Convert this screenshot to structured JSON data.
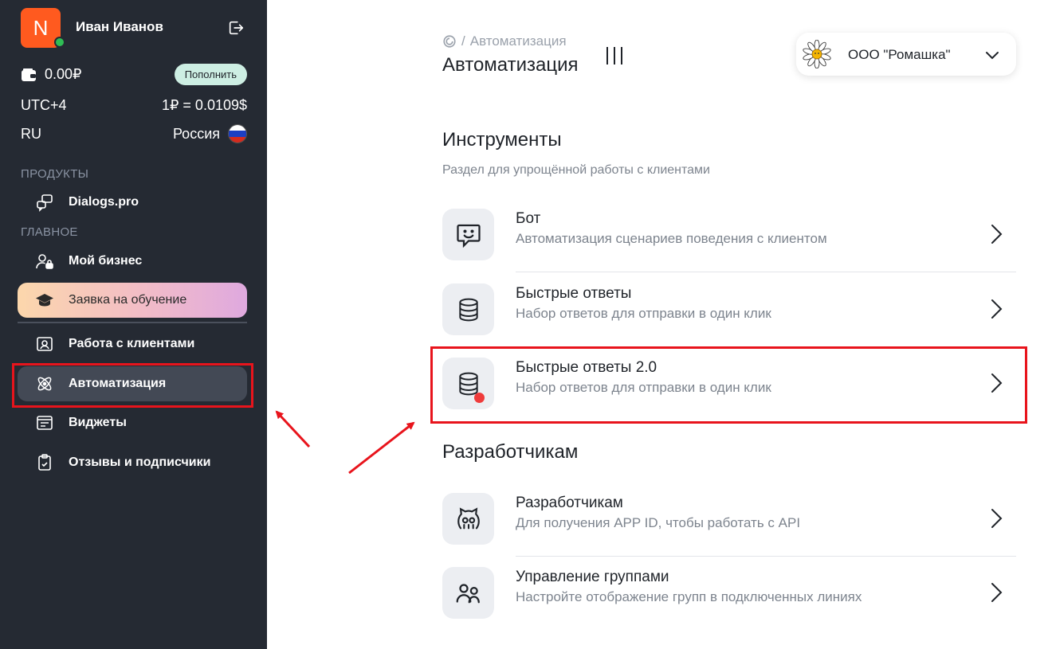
{
  "user": {
    "avatar_letter": "N",
    "name": "Иван Иванов"
  },
  "account": {
    "balance": "0.00₽",
    "topup_label": "Пополнить",
    "timezone": "UTC+4",
    "rate": "1₽ = 0.0109$",
    "language": "RU",
    "country": "Россия"
  },
  "sidebar": {
    "products_label": "ПРОДУКТЫ",
    "product": "Dialogs.pro",
    "main_label": "ГЛАВНОЕ",
    "items": [
      {
        "label": "Мой бизнес",
        "icon": "user-lock-icon"
      },
      {
        "label": "Заявка на обучение",
        "icon": "graduation-cap-icon"
      },
      {
        "label": "Работа с клиентами",
        "icon": "contact-card-icon"
      },
      {
        "label": "Автоматизация",
        "icon": "atom-icon"
      },
      {
        "label": "Виджеты",
        "icon": "widget-list-icon"
      },
      {
        "label": "Отзывы и подписчики",
        "icon": "clipboard-check-icon"
      }
    ]
  },
  "header": {
    "breadcrumb": "Автоматизация",
    "title": "Автоматизация",
    "org_name": "ООО \"Ромашка\""
  },
  "sections": {
    "tools": {
      "title": "Инструменты",
      "subtitle": "Раздел для упрощённой работы с клиентами",
      "cards": [
        {
          "title": "Бот",
          "desc": "Автоматизация сценариев поведения с клиентом",
          "icon": "chat-smile-icon"
        },
        {
          "title": "Быстрые ответы",
          "desc": "Набор ответов для отправки в один клик",
          "icon": "database-icon"
        },
        {
          "title": "Быстрые ответы 2.0",
          "desc": "Набор ответов для отправки в один клик",
          "icon": "database-icon"
        }
      ]
    },
    "dev": {
      "title": "Разработчикам",
      "cards": [
        {
          "title": "Разработчикам",
          "desc": "Для получения APP ID, чтобы работать с API",
          "icon": "octocat-icon"
        },
        {
          "title": "Управление группами",
          "desc": "Настройте отображение групп в подключенных линиях",
          "icon": "users-icon"
        }
      ]
    }
  },
  "colors": {
    "sidebar_bg": "#252a33",
    "accent_orange": "#ff5a1f",
    "highlight_red": "#e8141c"
  }
}
